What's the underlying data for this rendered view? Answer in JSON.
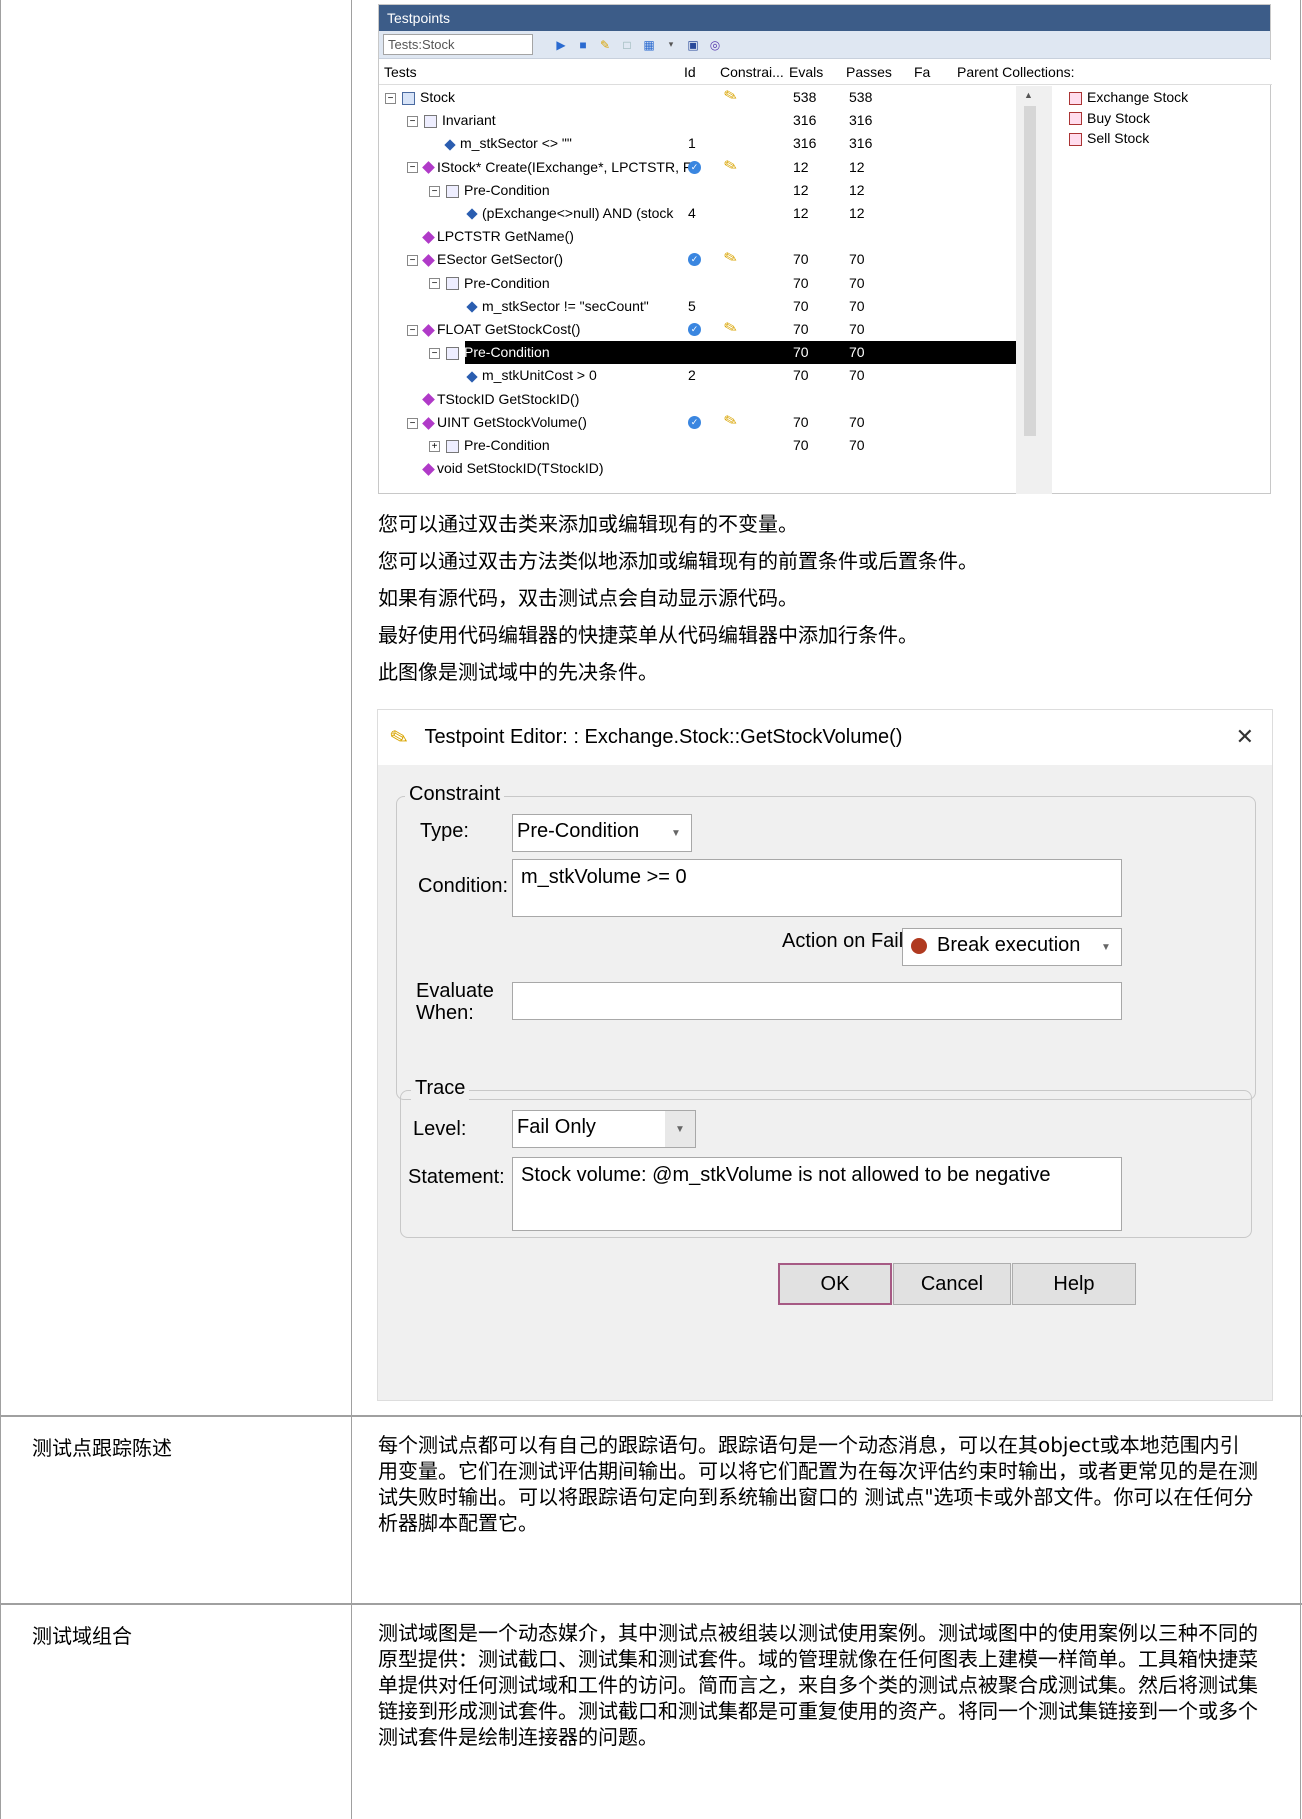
{
  "testpoints": {
    "title": "Testpoints",
    "combo": "Tests:Stock",
    "columns": [
      "Tests",
      "Id",
      "Constrai...",
      "Evals",
      "Passes",
      "Fa",
      "Parent Collections:"
    ],
    "rows": [
      {
        "level": 0,
        "exp": "⊟",
        "icon": "class",
        "text": "Stock",
        "id": "",
        "pen": true,
        "check": false,
        "evals": "538",
        "passes": "538"
      },
      {
        "level": 1,
        "exp": "⊟",
        "icon": "inv",
        "text": "Invariant",
        "id": "",
        "pen": false,
        "check": false,
        "evals": "316",
        "passes": "316"
      },
      {
        "level": 2,
        "exp": "",
        "icon": "diamond",
        "text": "m_stkSector <> \"\"",
        "id": "1",
        "pen": false,
        "check": false,
        "evals": "316",
        "passes": "316"
      },
      {
        "level": 1,
        "exp": "⊟",
        "icon": "method",
        "text": "IStock* Create(IExchange*, LPCTSTR, F",
        "id": "",
        "pen": true,
        "check": true,
        "evals": "12",
        "passes": "12"
      },
      {
        "level": 2,
        "exp": "⊟",
        "icon": "inv",
        "text": "Pre-Condition",
        "id": "",
        "pen": false,
        "check": false,
        "evals": "12",
        "passes": "12"
      },
      {
        "level": 3,
        "exp": "",
        "icon": "diamond",
        "text": "(pExchange<>null) AND (stock",
        "id": "4",
        "pen": false,
        "check": false,
        "evals": "12",
        "passes": "12"
      },
      {
        "level": 1,
        "exp": "",
        "icon": "method",
        "text": "LPCTSTR GetName()",
        "id": "",
        "pen": false,
        "check": false,
        "evals": "",
        "passes": ""
      },
      {
        "level": 1,
        "exp": "⊟",
        "icon": "method",
        "text": "ESector GetSector()",
        "id": "",
        "pen": true,
        "check": true,
        "evals": "70",
        "passes": "70"
      },
      {
        "level": 2,
        "exp": "⊟",
        "icon": "inv",
        "text": "Pre-Condition",
        "id": "",
        "pen": false,
        "check": false,
        "evals": "70",
        "passes": "70"
      },
      {
        "level": 3,
        "exp": "",
        "icon": "diamond",
        "text": "m_stkSector != \"secCount\"",
        "id": "5",
        "pen": false,
        "check": false,
        "evals": "70",
        "passes": "70"
      },
      {
        "level": 1,
        "exp": "⊟",
        "icon": "method",
        "text": "FLOAT GetStockCost()",
        "id": "",
        "pen": true,
        "check": true,
        "evals": "70",
        "passes": "70"
      },
      {
        "level": 2,
        "exp": "⊟",
        "icon": "inv",
        "text": "Pre-Condition",
        "id": "",
        "pen": false,
        "check": false,
        "evals": "70",
        "passes": "70",
        "selected": true
      },
      {
        "level": 3,
        "exp": "",
        "icon": "diamond",
        "text": "m_stkUnitCost > 0",
        "id": "2",
        "pen": false,
        "check": false,
        "evals": "70",
        "passes": "70"
      },
      {
        "level": 1,
        "exp": "",
        "icon": "method",
        "text": "TStockID GetStockID()",
        "id": "",
        "pen": false,
        "check": false,
        "evals": "",
        "passes": ""
      },
      {
        "level": 1,
        "exp": "⊟",
        "icon": "method",
        "text": "UINT GetStockVolume()",
        "id": "",
        "pen": true,
        "check": true,
        "evals": "70",
        "passes": "70"
      },
      {
        "level": 2,
        "exp": "⊞",
        "icon": "inv",
        "text": "Pre-Condition",
        "id": "",
        "pen": false,
        "check": false,
        "evals": "70",
        "passes": "70"
      },
      {
        "level": 1,
        "exp": "",
        "icon": "method",
        "text": "void SetStockID(TStockID)",
        "id": "",
        "pen": false,
        "check": false,
        "evals": "",
        "passes": ""
      }
    ],
    "parents": [
      "Exchange Stock",
      "Buy Stock",
      "Sell Stock"
    ]
  },
  "paras": [
    "您可以通过双击类来添加或编辑现有的不变量。",
    "您可以通过双击方法类似地添加或编辑现有的前置条件或后置条件。",
    "如果有源代码，双击测试点会自动显示源代码。",
    "最好使用代码编辑器的快捷菜单从代码编辑器中添加行条件。",
    "此图像是测试域中的先决条件。"
  ],
  "dialog": {
    "title": "Testpoint Editor: : Exchange.Stock::GetStockVolume()",
    "constraint_group": "Constraint",
    "type_label": "Type:",
    "type_value": "Pre-Condition",
    "condition_label": "Condition:",
    "condition_value": "m_stkVolume >= 0",
    "action_label": "Action on Fail:",
    "action_value": "Break execution",
    "evaluate_label": "Evaluate\nWhen:",
    "trace_group": "Trace",
    "level_label": "Level:",
    "level_value": "Fail Only",
    "statement_label": "Statement:",
    "statement_value": "Stock volume: @m_stkVolume is not allowed to be negative",
    "ok": "OK",
    "cancel": "Cancel",
    "help": "Help"
  },
  "rows": [
    {
      "left": "测试点跟踪陈述",
      "right": "每个测试点都可以有自己的跟踪语句。跟踪语句是一个动态消息，可以在其object或本地范围内引用变量。它们在测试评估期间输出。可以将它们配置为在每次评估约束时输出，或者更常见的是在测试失败时输出。可以将跟踪语句定向到系统输出窗口的 测试点\"选项卡或外部文件。你可以在任何分析器脚本配置它。"
    },
    {
      "left": "测试域组合",
      "right": "测试域图是一个动态媒介，其中测试点被组装以测试使用案例。测试域图中的使用案例以三种不同的原型提供：测试截口、测试集和测试套件。域的管理就像在任何图表上建模一样简单。工具箱快捷菜单提供对任何测试域和工件的访问。简而言之，来自多个类的测试点被聚合成测试集。然后将测试集链接到形成测试套件。测试截口和测试集都是可重复使用的资产。将同一个测试集链接到一个或多个测试套件是绘制连接器的问题。"
    }
  ]
}
